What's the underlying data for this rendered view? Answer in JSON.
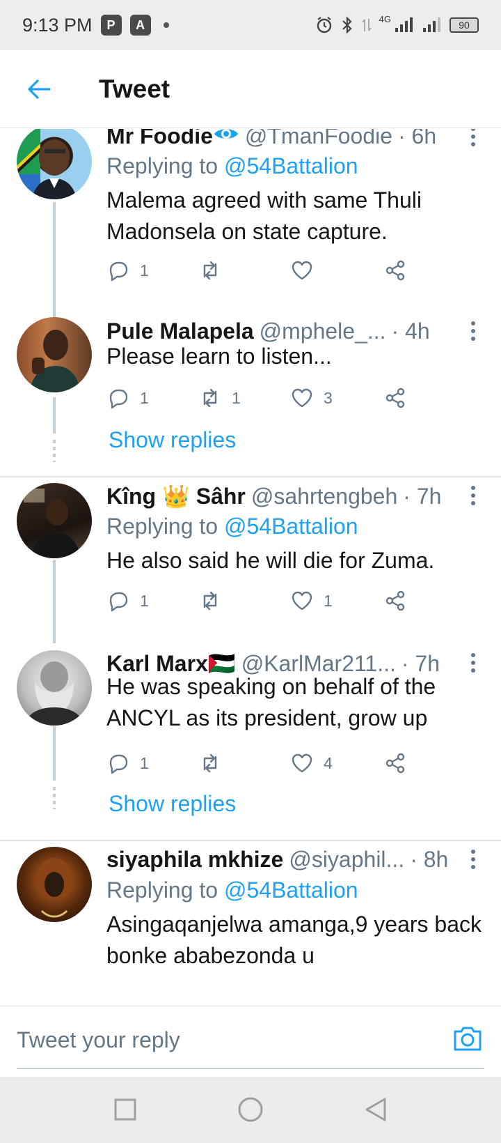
{
  "status_bar": {
    "time": "9:13 PM",
    "app_icons": [
      "P",
      "A"
    ],
    "network": "4G",
    "battery": "90"
  },
  "header": {
    "back_icon": "arrow-left-icon",
    "title": "Tweet"
  },
  "tweets": [
    {
      "name": "Mr Foodie",
      "name_badge": "👁‍🗨",
      "handle": "@TmanFoodie",
      "time": "· 6h",
      "replying_prefix": "Replying to",
      "replying_to": "@54Battalion",
      "text": "Malema agreed with same Thuli Madonsela on state capture.",
      "counts": {
        "reply": "1",
        "retweet": "",
        "like": ""
      }
    },
    {
      "name": "Pule Malapela",
      "name_badge": "",
      "handle": "@mphele_...",
      "time": "· 4h",
      "text": "Please learn to listen...",
      "counts": {
        "reply": "1",
        "retweet": "1",
        "like": "3"
      },
      "show_replies": "Show replies"
    },
    {
      "name": "Kîng 👑 Sâhr",
      "name_badge": "",
      "handle": "@sahrtengbeh",
      "time": "· 7h",
      "replying_prefix": "Replying to",
      "replying_to": "@54Battalion",
      "text": "He also said he will die for Zuma.",
      "counts": {
        "reply": "1",
        "retweet": "",
        "like": "1"
      }
    },
    {
      "name": "Karl Marx🇵🇸",
      "name_badge": "",
      "handle": "@KarlMar211...",
      "time": "· 7h",
      "text": "He was speaking on behalf of the ANCYL as its president, grow up",
      "counts": {
        "reply": "1",
        "retweet": "",
        "like": "4"
      },
      "show_replies": "Show replies"
    },
    {
      "name": "siyaphila mkhize",
      "name_badge": "",
      "handle": "@siyaphil...",
      "time": "· 8h",
      "replying_prefix": "Replying to",
      "replying_to": "@54Battalion",
      "text": "Asingaqanjelwa amanga,9 years back bonke ababezonda u",
      "counts": {
        "reply": "",
        "retweet": "",
        "like": ""
      }
    }
  ],
  "reply_bar": {
    "placeholder": "Tweet your reply",
    "camera_icon": "camera-icon"
  },
  "nav_bar": {
    "icons": [
      "square-recents-icon",
      "circle-home-icon",
      "triangle-back-icon"
    ]
  },
  "colors": {
    "accent": "#1da1f2",
    "secondary_text": "#657786",
    "primary_text": "#14171a",
    "divider": "#dfe3e6"
  }
}
